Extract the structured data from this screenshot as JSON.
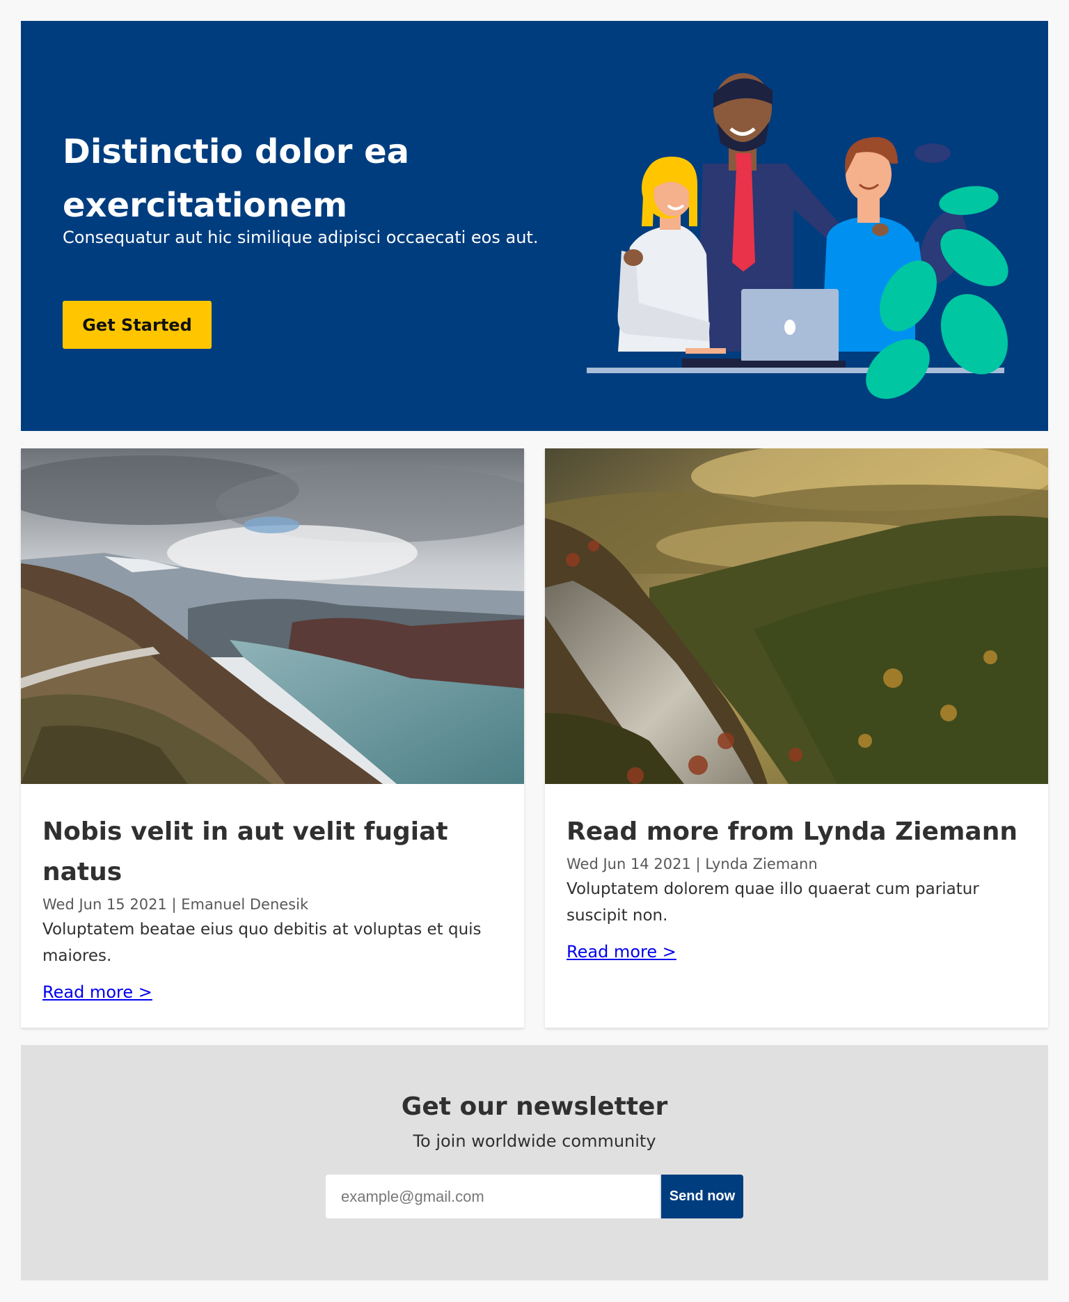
{
  "hero": {
    "title": "Distinctio dolor ea exercitationem",
    "subtitle": "Consequatur aut hic similique adipisci occaecati eos aut.",
    "cta_label": "Get Started",
    "background_color": "#003d7f",
    "cta_color": "#ffc600",
    "illustration": "team-with-laptop-illustration"
  },
  "posts": [
    {
      "image": "mountain-lake-photo",
      "title": "Nobis velit in aut velit fugiat natus",
      "meta": "Wed Jun 15 2021 | Emanuel Denesik",
      "excerpt": "Voluptatem beatae eius quo debitis at voluptas et quis maiores.",
      "link_label": "Read more >"
    },
    {
      "image": "forest-valley-photo",
      "title": "Read more from Lynda Ziemann",
      "meta": "Wed Jun 14 2021 | Lynda Ziemann",
      "excerpt": "Voluptatem dolorem quae illo quaerat cum pariatur suscipit non.",
      "link_label": "Read more >"
    }
  ],
  "newsletter": {
    "title": "Get our newsletter",
    "subtitle": "To join worldwide community",
    "email_placeholder": "example@gmail.com",
    "button_label": "Send now",
    "background_color": "#e0e0e0"
  }
}
